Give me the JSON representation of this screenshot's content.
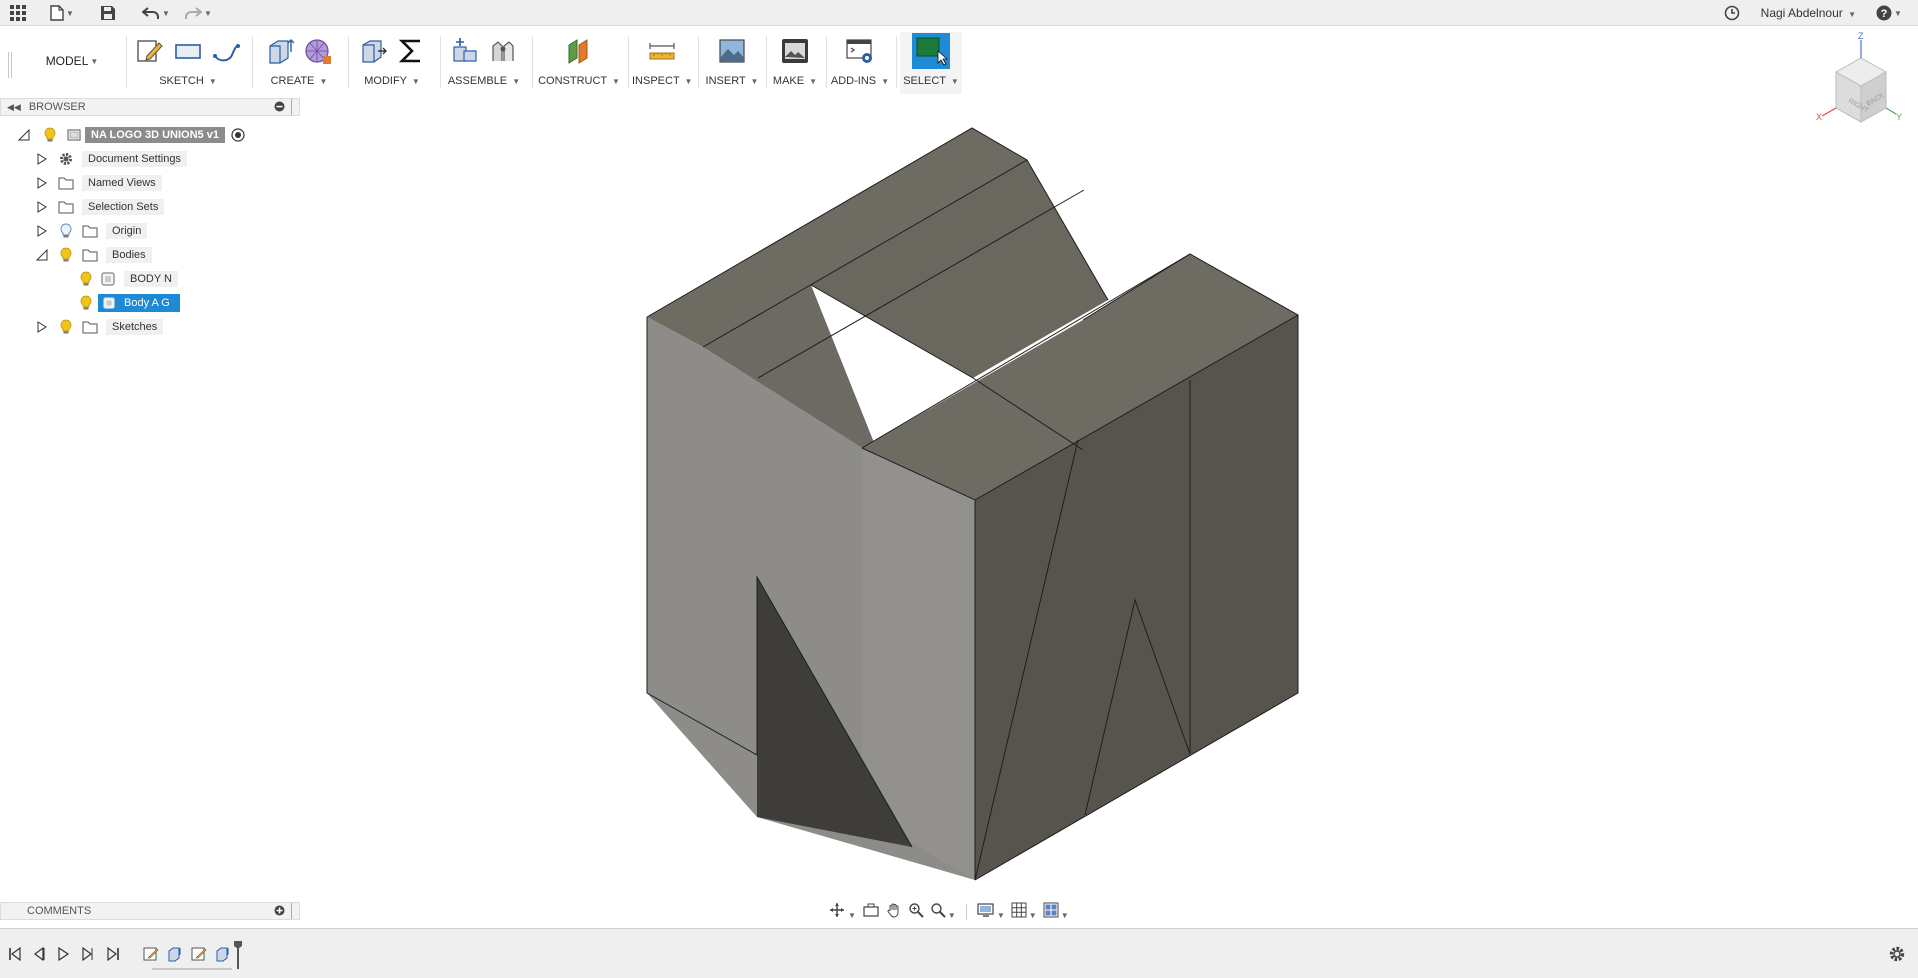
{
  "app_bar": {
    "user_name": "Nagi Abdelnour",
    "help_label": "?"
  },
  "toolbar": {
    "workspace": "MODEL",
    "groups": [
      {
        "label": "SKETCH"
      },
      {
        "label": "CREATE"
      },
      {
        "label": "MODIFY"
      },
      {
        "label": "ASSEMBLE"
      },
      {
        "label": "CONSTRUCT"
      },
      {
        "label": "INSPECT"
      },
      {
        "label": "INSERT"
      },
      {
        "label": "MAKE"
      },
      {
        "label": "ADD-INS"
      },
      {
        "label": "SELECT"
      }
    ]
  },
  "browser": {
    "title": "BROWSER",
    "root": "NA LOGO 3D UNION5 v1",
    "items": [
      {
        "label": "Document Settings",
        "icon": "gear-icon"
      },
      {
        "label": "Named Views",
        "icon": "folder-icon"
      },
      {
        "label": "Selection Sets",
        "icon": "folder-icon"
      },
      {
        "label": "Origin",
        "icon": "folder-icon"
      },
      {
        "label": "Bodies",
        "icon": "folder-icon"
      },
      {
        "label": "BODY N",
        "icon": "body-icon"
      },
      {
        "label": "Body A G",
        "icon": "body-icon"
      },
      {
        "label": "Sketches",
        "icon": "folder-icon"
      }
    ]
  },
  "comments": {
    "title": "COMMENTS"
  },
  "viewcube": {
    "faces": [
      "RIGHT",
      "BACK"
    ],
    "axes": [
      "X",
      "Y",
      "Z"
    ]
  },
  "colors": {
    "accent": "#1e8ad6",
    "top_face": "#6e6b63",
    "left_face": "#8d8c88",
    "right_face": "#57544e"
  }
}
